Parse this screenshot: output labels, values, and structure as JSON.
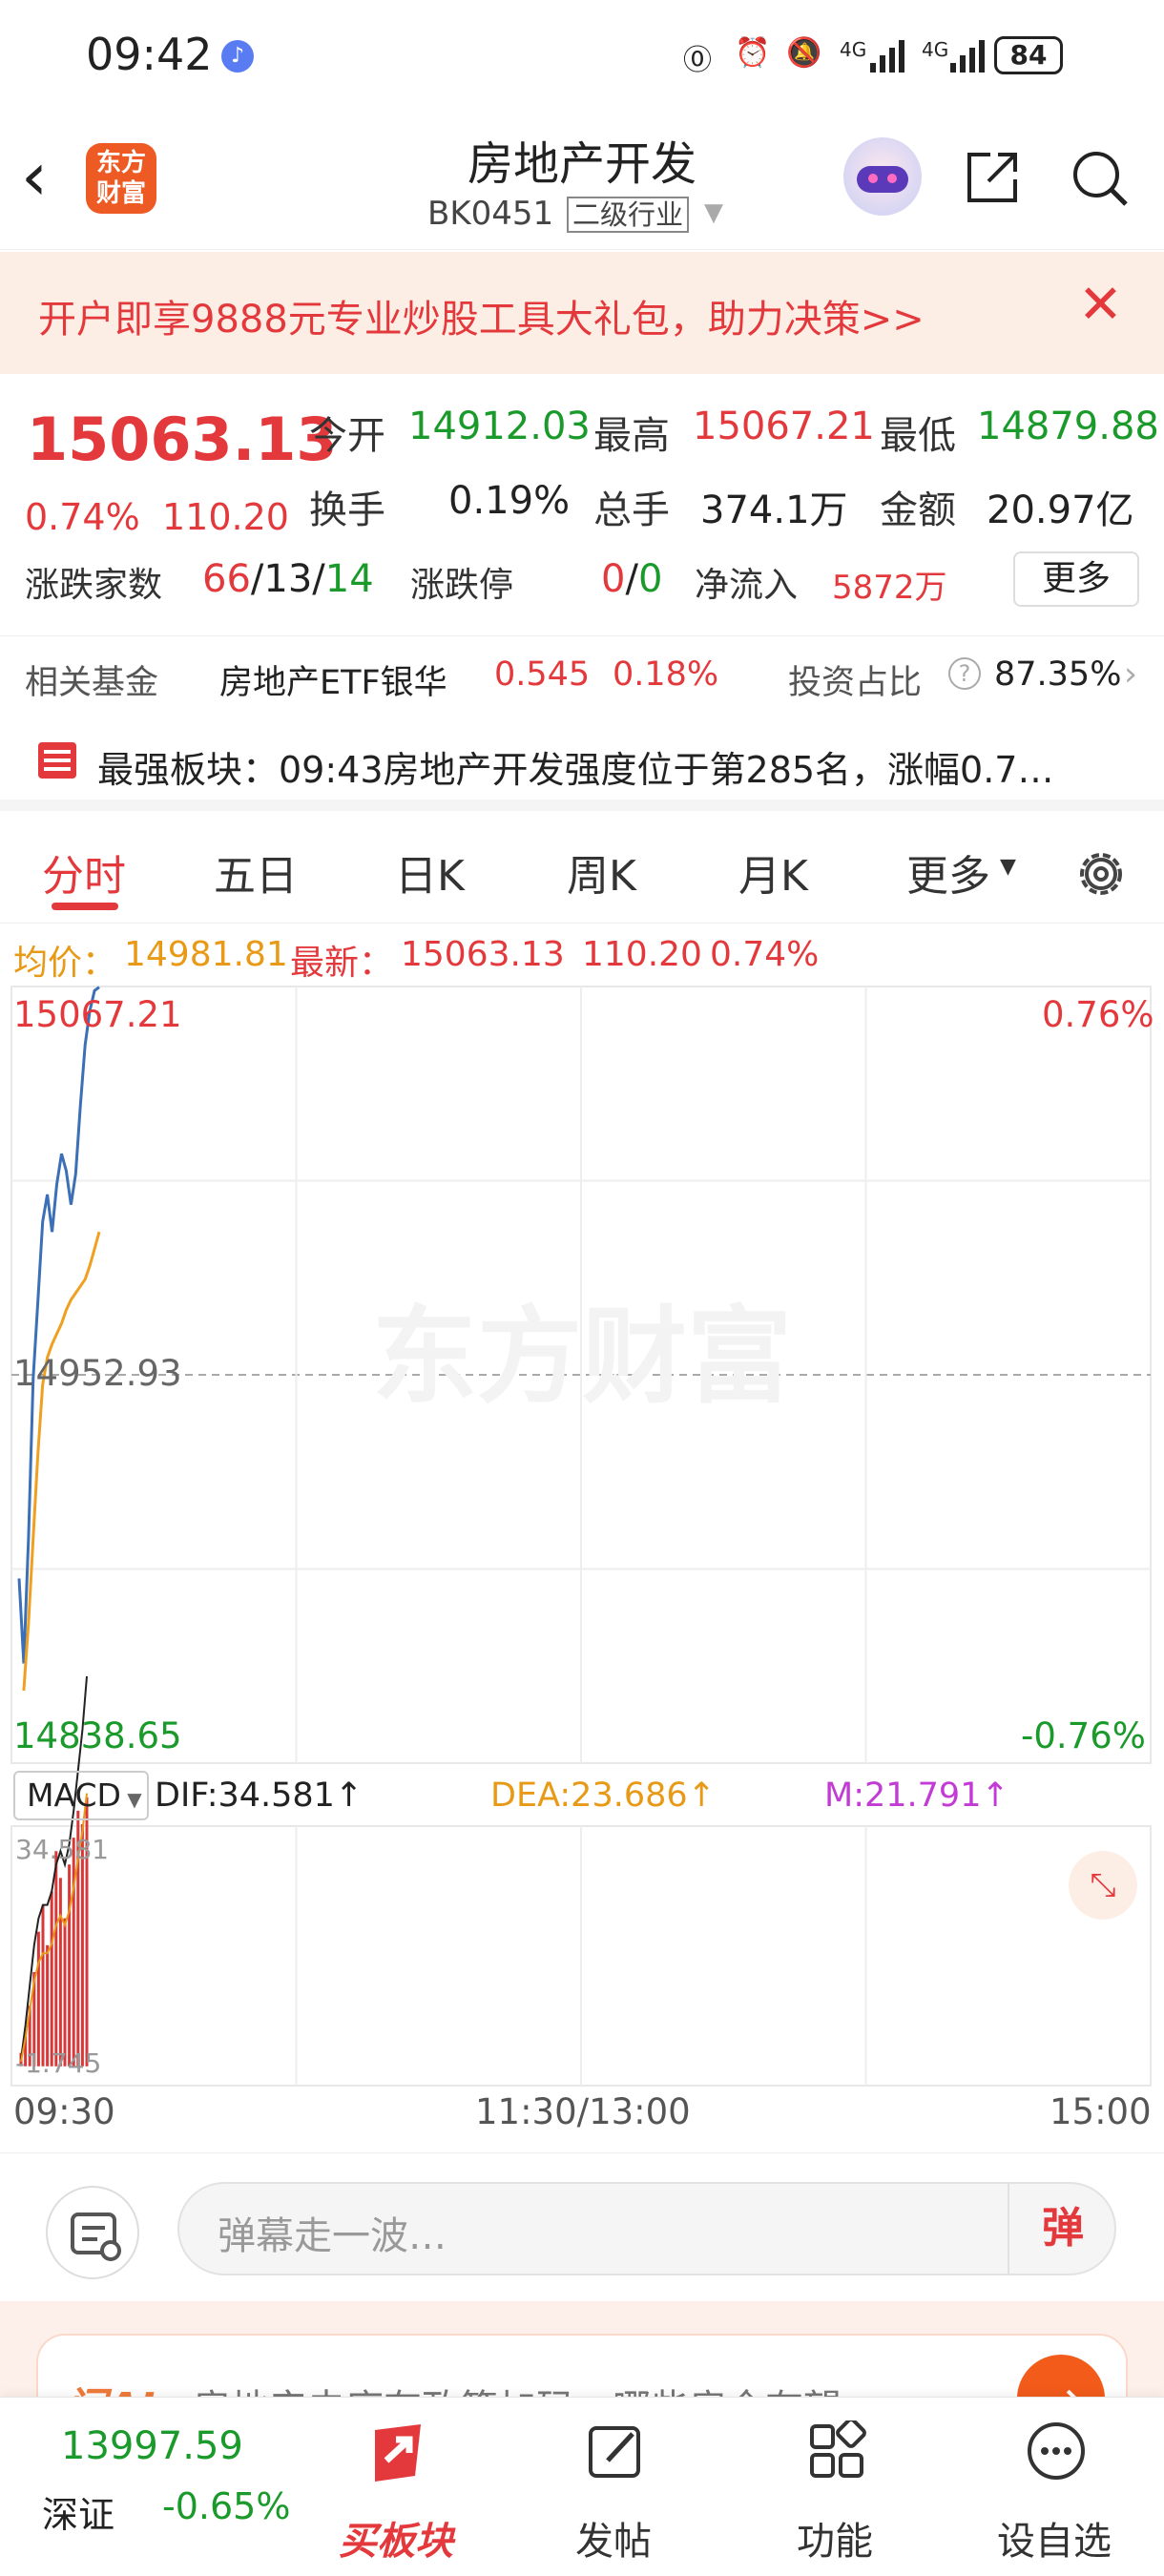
{
  "status": {
    "time": "09:42",
    "network1": "4G",
    "network2": "4G",
    "battery": "84"
  },
  "header": {
    "logo_line1": "东方",
    "logo_line2": "财富",
    "title": "房地产开发",
    "code": "BK0451",
    "level": "二级行业"
  },
  "ad": {
    "text": "开户即享9888元专业炒股工具大礼包，助力决策>>"
  },
  "quote": {
    "price": "15063.13",
    "change_pct": "0.74%",
    "change_abs": "110.20",
    "open_label": "今开",
    "open": "14912.03",
    "high_label": "最高",
    "high": "15067.21",
    "low_label": "最低",
    "low": "14879.88",
    "turnover_label": "换手",
    "turnover": "0.19%",
    "volume_label": "总手",
    "volume": "374.1万",
    "amount_label": "金额",
    "amount": "20.97亿",
    "updown_label": "涨跌家数",
    "up": "66",
    "flat": "13",
    "down": "14",
    "limit_label": "涨跌停",
    "limit_up": "0",
    "limit_down": "0",
    "inflow_label": "净流入",
    "inflow": "5872万",
    "more": "更多",
    "sep": "/"
  },
  "fund": {
    "label": "相关基金",
    "name": "房地产ETF银华",
    "price": "0.545",
    "pct": "0.18%",
    "ratio_label": "投资占比",
    "ratio": "87.35%"
  },
  "strong": {
    "text": "最强板块：09:43房地产开发强度位于第285名，涨幅0.7…"
  },
  "tabs": [
    "分时",
    "五日",
    "日K",
    "周K",
    "月K",
    "更多"
  ],
  "info": {
    "avg_label": "均价：",
    "avg": "14981.81",
    "latest_label": "最新：",
    "latest": "15063.13",
    "chg": "110.20",
    "pct": "0.74%"
  },
  "chart_data": {
    "type": "line",
    "title": "",
    "xlabel": "",
    "ylabel": "",
    "ylim": [
      14838.65,
      15067.21
    ],
    "y_max_label": "15067.21",
    "y_mid_label": "14952.93",
    "y_min_label": "14838.65",
    "pct_max_label": "0.76%",
    "pct_min_label": "-0.76%",
    "x_ticks": [
      "09:30",
      "11:30/13:00",
      "15:00"
    ],
    "watermark": "东方财富",
    "series": [
      {
        "name": "最新",
        "color": "#3b6fb6",
        "x": [
          0,
          1,
          2,
          3,
          4,
          5,
          6,
          7,
          8,
          9,
          10,
          11,
          12,
          13,
          14,
          15,
          16,
          17
        ],
        "values": [
          14893,
          14868,
          14905,
          14952,
          14975,
          14998,
          15006,
          14995,
          15009,
          15018,
          15013,
          15003,
          15012,
          15032,
          15050,
          15060,
          15066,
          15067
        ]
      },
      {
        "name": "均价",
        "color": "#f0a020",
        "x": [
          1,
          2,
          3,
          4,
          5,
          6,
          7,
          8,
          9,
          10,
          11,
          12,
          13,
          14,
          15,
          16,
          17
        ],
        "values": [
          14860,
          14880,
          14905,
          14930,
          14950,
          14958,
          14962,
          14965,
          14968,
          14972,
          14975,
          14977,
          14979,
          14981,
          14985,
          14990,
          14995
        ]
      }
    ]
  },
  "macd": {
    "selector": "MACD",
    "dif": "DIF:34.581↑",
    "dea": "DEA:23.686↑",
    "m": "M:21.791↑",
    "top_label": "34.581",
    "bottom_label": "-1.745",
    "bars": [
      2,
      5,
      9,
      14,
      20,
      24,
      18,
      26,
      32,
      28,
      22,
      30,
      34,
      38,
      36,
      40
    ],
    "dif_line": [
      1,
      6,
      12,
      18,
      22,
      24,
      24,
      26,
      30,
      32,
      30,
      33,
      38,
      44,
      50,
      58
    ],
    "range": [
      -1.745,
      34.581
    ]
  },
  "comment": {
    "placeholder": "弹幕走一波…",
    "danmu": "弹"
  },
  "ai": {
    "badge": "问AI",
    "question": "房地产去库存政策加码，哪些房企有望"
  },
  "bottom": {
    "index_value": "13997.59",
    "index_name": "深证",
    "index_change": "-0.65%",
    "nav": [
      "买板块",
      "发帖",
      "功能",
      "设自选"
    ]
  }
}
